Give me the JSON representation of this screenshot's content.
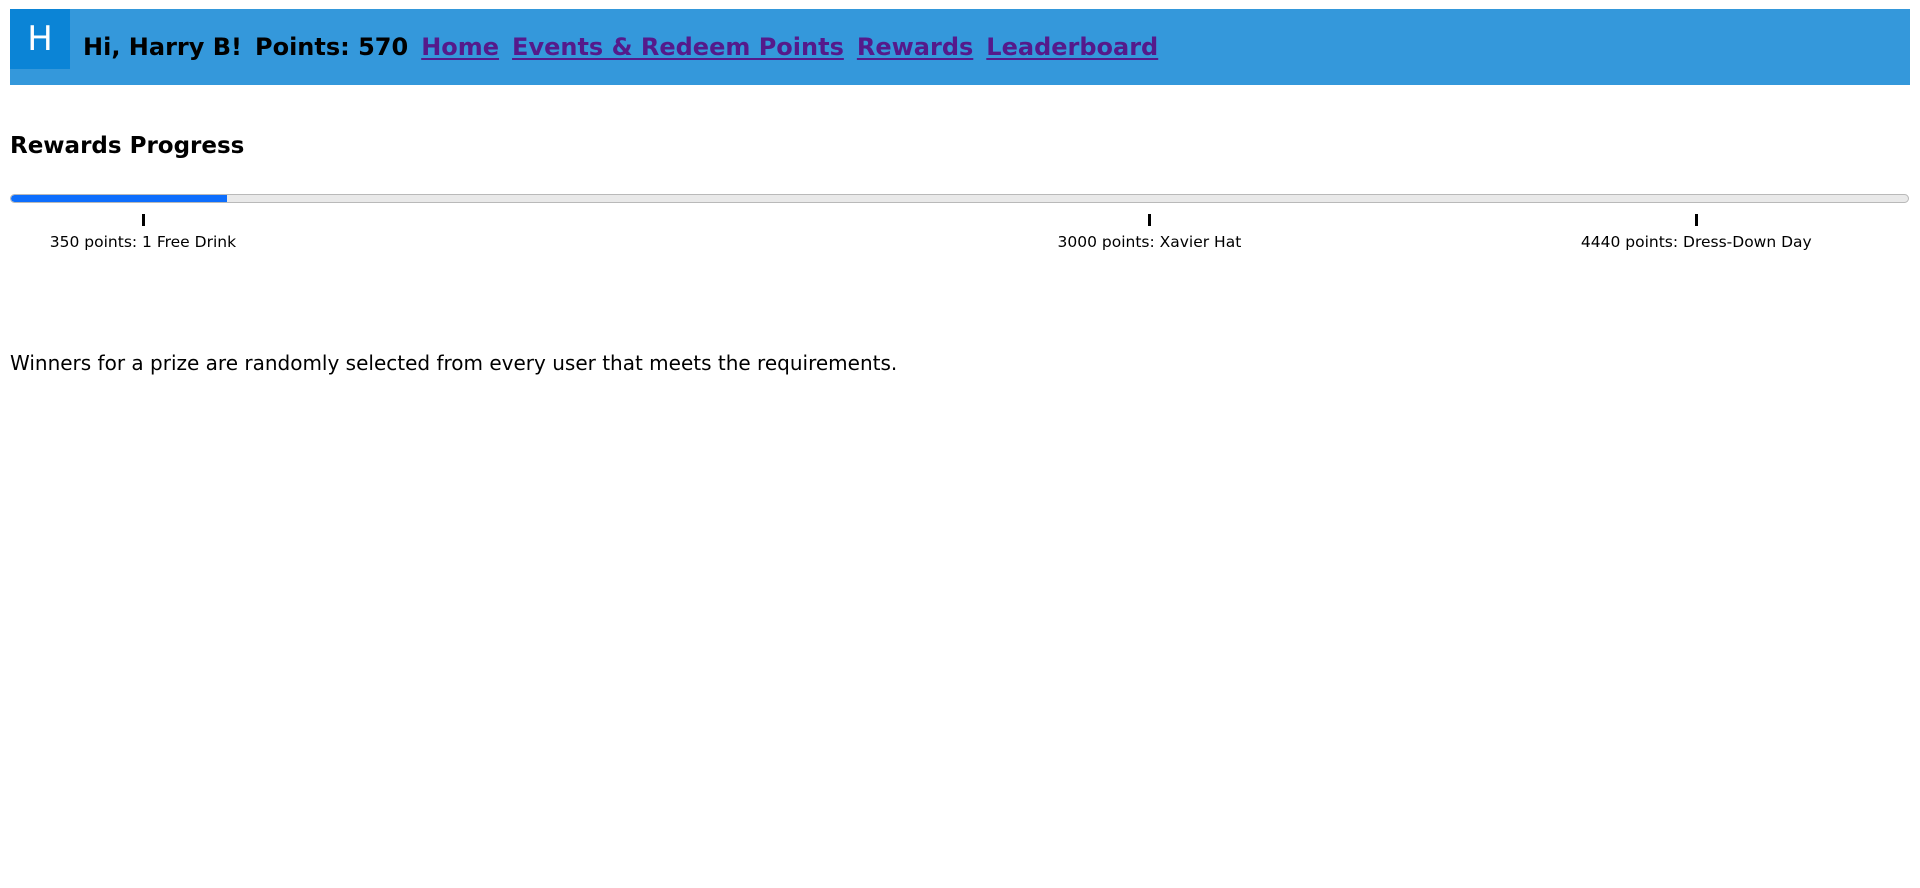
{
  "header": {
    "avatar_letter": "H",
    "greeting": "Hi, Harry B!",
    "points": "Points: 570",
    "nav": [
      {
        "label": "Home"
      },
      {
        "label": "Events & Redeem Points"
      },
      {
        "label": "Rewards"
      },
      {
        "label": "Leaderboard"
      }
    ],
    "bg_color": "#3498db",
    "link_color": "#551a8b"
  },
  "page": {
    "title": "Rewards Progress",
    "footnote": "Winners for a prize are randomly selected from every user that meets the requirements."
  },
  "progress": {
    "current_points": 570,
    "max_points": 5000,
    "fill_color": "#0d6efd",
    "milestones": [
      {
        "points": 350,
        "label": "350 points: 1 Free Drink"
      },
      {
        "points": 3000,
        "label": "3000 points: Xavier Hat"
      },
      {
        "points": 4440,
        "label": "4440 points: Dress-Down Day"
      }
    ]
  }
}
